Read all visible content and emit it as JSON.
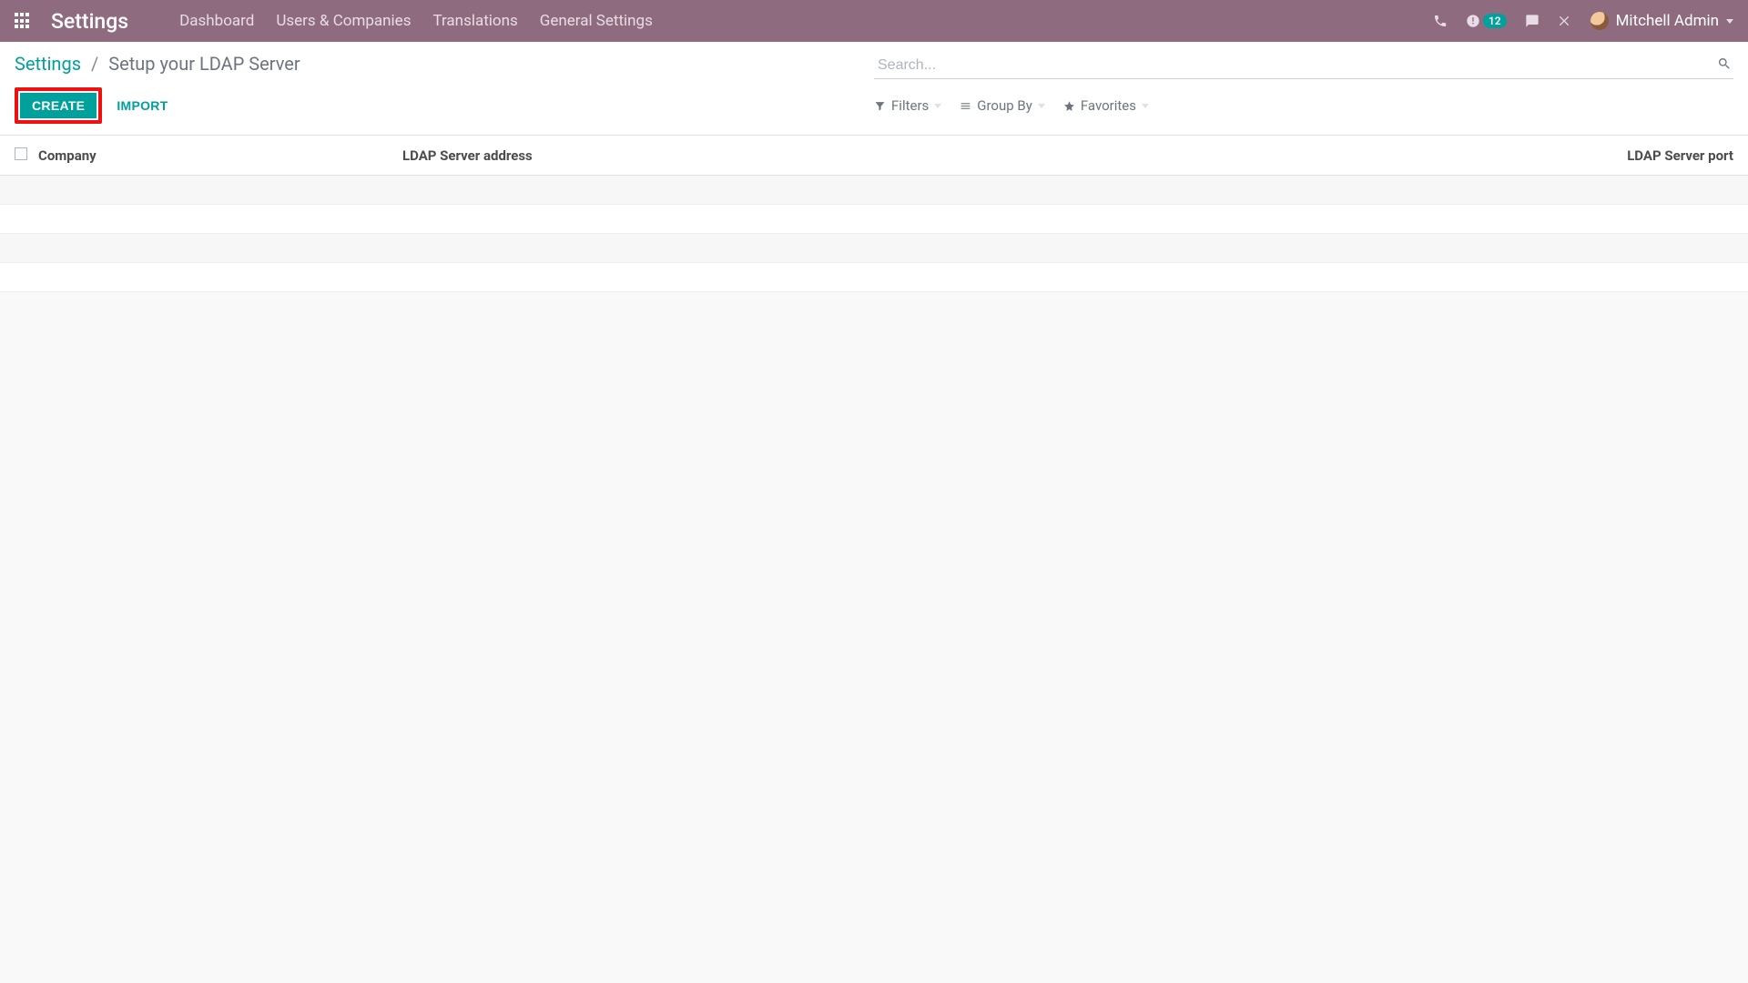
{
  "topnav": {
    "app_title": "Settings",
    "links": [
      "Dashboard",
      "Users & Companies",
      "Translations",
      "General Settings"
    ],
    "badge_count": "12",
    "user_name": "Mitchell Admin"
  },
  "breadcrumb": {
    "root": "Settings",
    "sep": "/",
    "current": "Setup your LDAP Server"
  },
  "search": {
    "placeholder": "Search..."
  },
  "actions": {
    "create_label": "CREATE",
    "import_label": "IMPORT"
  },
  "filters": {
    "filters_label": "Filters",
    "groupby_label": "Group By",
    "favorites_label": "Favorites"
  },
  "columns": {
    "company": "Company",
    "address": "LDAP Server address",
    "port": "LDAP Server port"
  }
}
